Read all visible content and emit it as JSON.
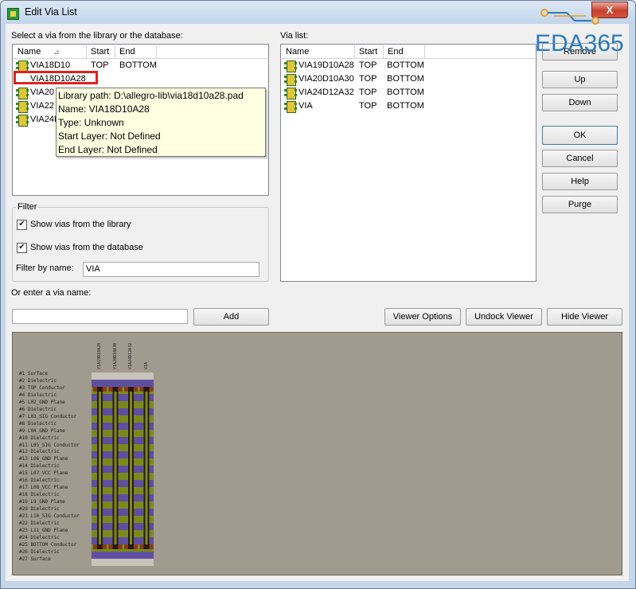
{
  "window": {
    "title": "Edit Via List",
    "close_label": "X"
  },
  "library": {
    "label": "Select a via from the library or the database:",
    "columns": [
      "Name",
      "Start",
      "End"
    ],
    "rows": [
      {
        "name": "VIA18D10",
        "start": "TOP",
        "end": "BOTTOM"
      },
      {
        "name": "VIA18D10A28",
        "start": "",
        "end": ""
      },
      {
        "name": "VIA20",
        "start": "",
        "end": ""
      },
      {
        "name": "VIA22",
        "start": "",
        "end": ""
      },
      {
        "name": "VIA24D",
        "start": "",
        "end": ""
      }
    ]
  },
  "tooltip": {
    "lines": [
      "Library path: D:\\allegro-lib\\via18d10a28.pad",
      "Name: VIA18D10A28",
      "Type: Unknown",
      "Start Layer: Not Defined",
      "End Layer: Not Defined"
    ]
  },
  "via_list": {
    "label": "Via list:",
    "columns": [
      "Name",
      "Start",
      "End"
    ],
    "rows": [
      {
        "name": "VIA19D10A28",
        "start": "TOP",
        "end": "BOTTOM"
      },
      {
        "name": "VIA20D10A30",
        "start": "TOP",
        "end": "BOTTOM"
      },
      {
        "name": "VIA24D12A32",
        "start": "TOP",
        "end": "BOTTOM"
      },
      {
        "name": "VIA",
        "start": "TOP",
        "end": "BOTTOM"
      }
    ]
  },
  "buttons": {
    "remove": "Remove",
    "up": "Up",
    "down": "Down",
    "ok": "OK",
    "cancel": "Cancel",
    "help": "Help",
    "purge": "Purge",
    "add": "Add",
    "viewer_options": "Viewer Options",
    "undock_viewer": "Undock Viewer",
    "hide_viewer": "Hide Viewer"
  },
  "filter": {
    "title": "Filter",
    "show_library": "Show vias from the library",
    "show_library_checked": true,
    "show_database": "Show vias from the database",
    "show_database_checked": true,
    "filter_by_name_label": "Filter by name:",
    "filter_value": "VIA"
  },
  "enter_via": {
    "label": "Or enter a via name:",
    "value": ""
  },
  "viewer": {
    "columns": [
      "VIA19D10A28",
      "VIA20D10A30",
      "VIA24D12A32",
      "VIA"
    ],
    "layers": [
      "#1    Surface",
      "#2      Dielectric",
      "#3  TOP Conductor",
      "#4      Dielectric",
      "#5  L02_GND Plane",
      "#6      Dielectric",
      "#7  L03_SIG Conductor",
      "#8      Dielectric",
      "#9  L04_GND Plane",
      "#10     Dielectric",
      "#11  L05_SIG Conductor",
      "#12     Dielectric",
      "#13  L06_GND Plane",
      "#14     Dielectric",
      "#15  L07_VCC Plane",
      "#16     Dielectric",
      "#17  L08_VCC Plane",
      "#18     Dielectric",
      "#19  L9_GND Plane",
      "#20     Dielectric",
      "#21  L10_SIG Conductor",
      "#22     Dielectric",
      "#23  L11_GND Plane",
      "#24     Dielectric",
      "#25  BOTTOM Conductor",
      "#26     Dielectric",
      "#27   Surface"
    ]
  },
  "watermark": {
    "text": "EDA365"
  },
  "colors": {
    "viewer_bg": "#a19a8e",
    "dielectric": "#5f4fa0",
    "plane": "#7a8a1a",
    "pad": "#8b3a1a",
    "highlight": "#e02020"
  }
}
